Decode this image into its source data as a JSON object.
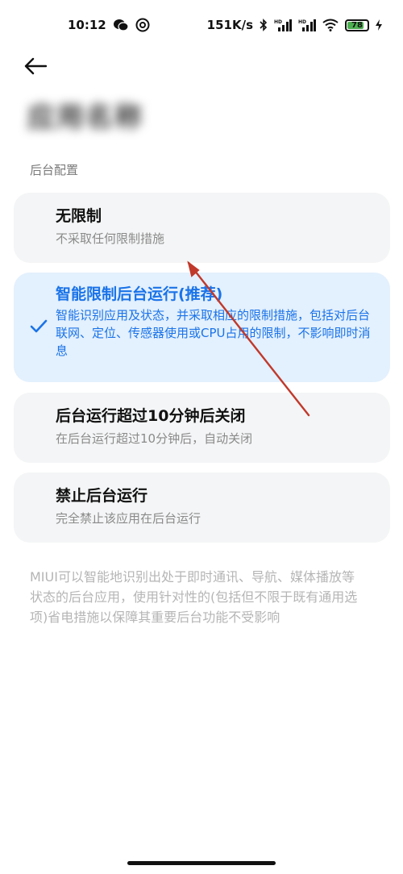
{
  "status_bar": {
    "time": "10:12",
    "net_speed": "151K/s",
    "signal_1_tag": "HD",
    "signal_2_tag": "HD",
    "battery_level": "78",
    "icons": [
      "wechat-icon",
      "at-icon",
      "bluetooth-icon",
      "signal-icon",
      "signal-icon",
      "wifi-icon",
      "battery-icon",
      "charging-icon"
    ]
  },
  "header": {
    "back_icon": "back-arrow-icon",
    "title": "应用名称"
  },
  "section": {
    "label": "后台配置"
  },
  "options": [
    {
      "title": "无限制",
      "desc": "不采取任何限制措施",
      "selected": false
    },
    {
      "title": "智能限制后台运行(推荐)",
      "desc": "智能识别应用及状态，并采取相应的限制措施，包括对后台联网、定位、传感器使用或CPU占用的限制，不影响即时消息",
      "selected": true
    },
    {
      "title": "后台运行超过10分钟后关闭",
      "desc": "在后台运行超过10分钟后，自动关闭",
      "selected": false
    },
    {
      "title": "禁止后台运行",
      "desc": "完全禁止该应用在后台运行",
      "selected": false
    }
  ],
  "footer": {
    "note": "MIUI可以智能地识别出处于即时通讯、导航、媒体播放等状态的后台应用，使用针对性的(包括但不限于既有通用选项)省电措施以保障其重要后台功能不受影响"
  },
  "colors": {
    "accent": "#1a73e8",
    "selected_bg": "#e3f0fd",
    "card_bg": "#f4f5f6",
    "annotation": "#c0392b"
  }
}
